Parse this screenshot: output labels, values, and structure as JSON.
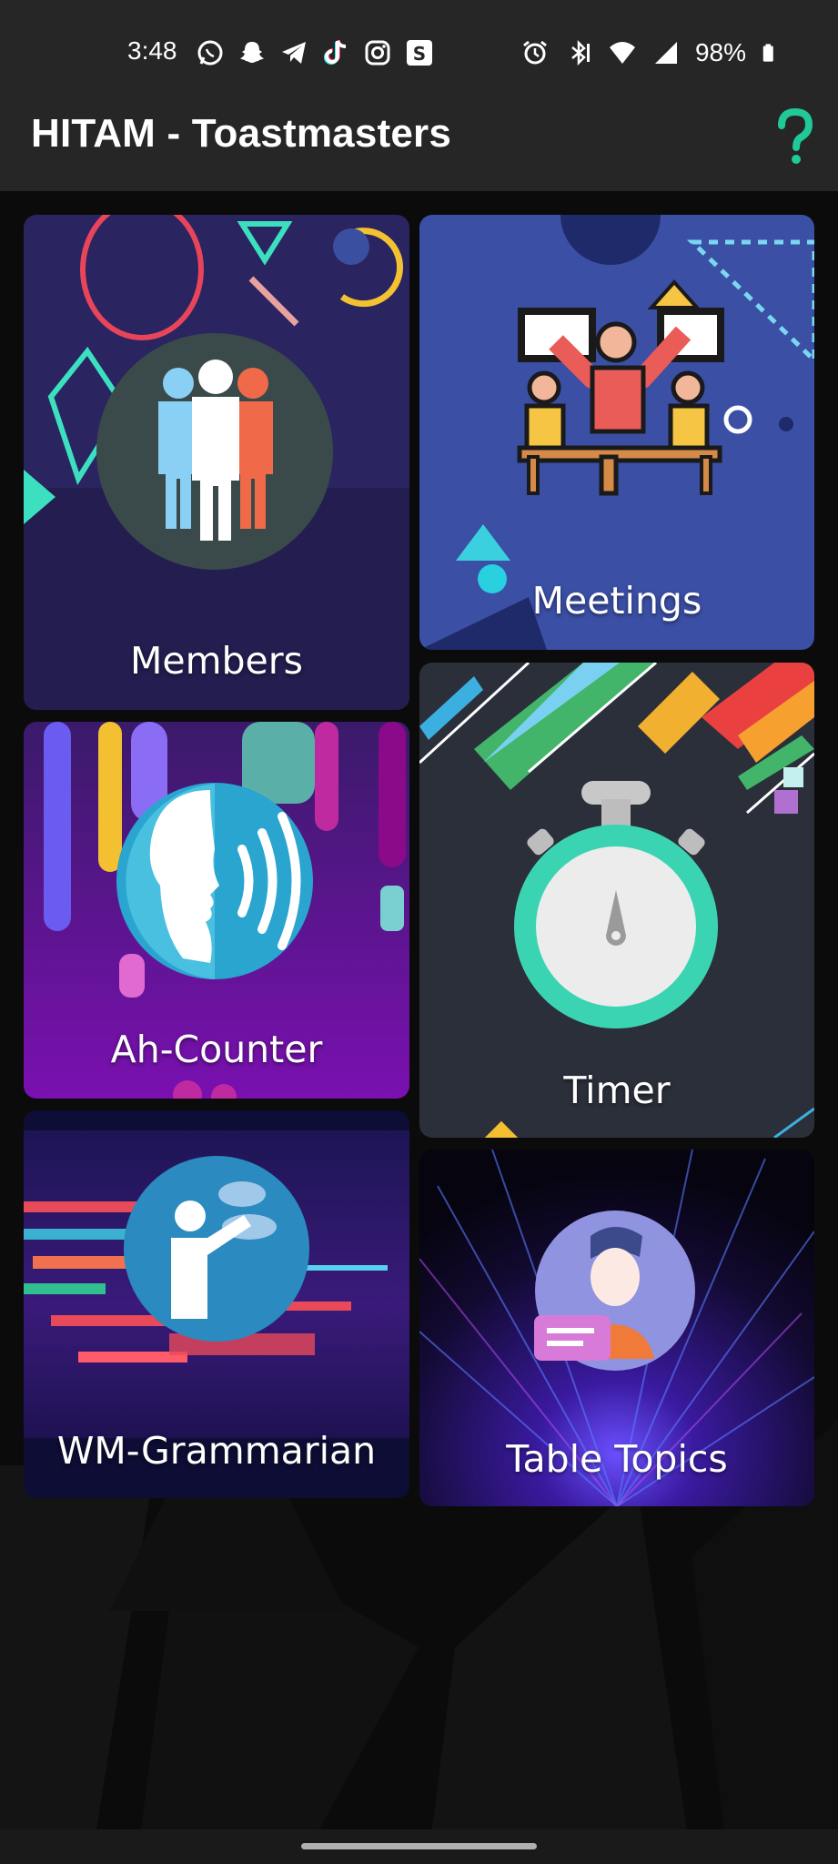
{
  "status_bar": {
    "time": "3:48",
    "left_icons": [
      "whatsapp-icon",
      "snapchat-icon",
      "telegram-icon",
      "tiktok-icon",
      "instagram-icon",
      "s-app-icon"
    ],
    "right_icons": [
      "alarm-icon",
      "bluetooth-icon",
      "wifi-icon",
      "signal-icon",
      "battery-icon"
    ],
    "battery": "98%"
  },
  "app_bar": {
    "title": "HITAM - Toastmasters",
    "help_icon": "help-icon",
    "help_color": "#20c997"
  },
  "cards": [
    {
      "id": "members",
      "label": "Members"
    },
    {
      "id": "meetings",
      "label": "Meetings"
    },
    {
      "id": "ah-counter",
      "label": "Ah-Counter"
    },
    {
      "id": "timer",
      "label": "Timer"
    },
    {
      "id": "wm-grammarian",
      "label": "WM-Grammarian"
    },
    {
      "id": "table-topics",
      "label": "Table Topics"
    }
  ]
}
